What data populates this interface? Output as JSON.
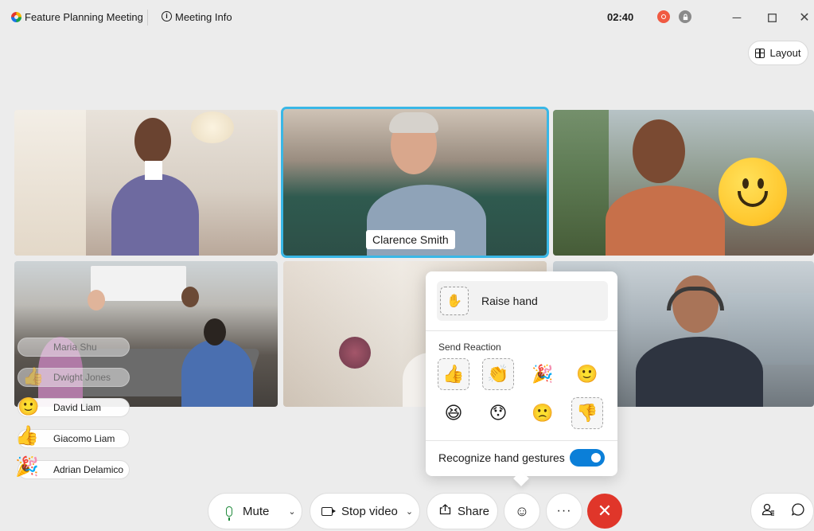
{
  "meeting": {
    "title": "Feature Planning Meeting",
    "info_label": "Meeting Info",
    "timer": "02:40"
  },
  "layout_button": {
    "label": "Layout"
  },
  "active_speaker": {
    "name": "Clarence Smith"
  },
  "participants": [
    {
      "name": "Maria Shu",
      "reaction": ""
    },
    {
      "name": "Dwight Jones",
      "reaction": "thumbs-up"
    },
    {
      "name": "David Liam",
      "reaction": "smile"
    },
    {
      "name": "Giacomo Liam",
      "reaction": "thumbs-up"
    },
    {
      "name": "Adrian Delamico",
      "reaction": "party-popper"
    }
  ],
  "popover": {
    "raise_hand_label": "Raise hand",
    "send_reaction_title": "Send Reaction",
    "reactions": [
      {
        "name": "thumbs-up",
        "glyph": "👍"
      },
      {
        "name": "clap",
        "glyph": "👏"
      },
      {
        "name": "party-popper",
        "glyph": "🎉"
      },
      {
        "name": "smile",
        "glyph": "🙂"
      },
      {
        "name": "laugh",
        "glyph": "😆"
      },
      {
        "name": "surprised",
        "glyph": "😯"
      },
      {
        "name": "sad",
        "glyph": "🙁"
      },
      {
        "name": "thumbs-down",
        "glyph": "👎"
      }
    ],
    "gesture_label": "Recognize hand gestures",
    "gesture_enabled": true
  },
  "controls": {
    "mute_label": "Mute",
    "video_label": "Stop video",
    "share_label": "Share"
  },
  "colors": {
    "accent": "#39b7e6",
    "toggle": "#0b7fd8",
    "end_call": "#e0362a",
    "recording": "#f05a42"
  }
}
